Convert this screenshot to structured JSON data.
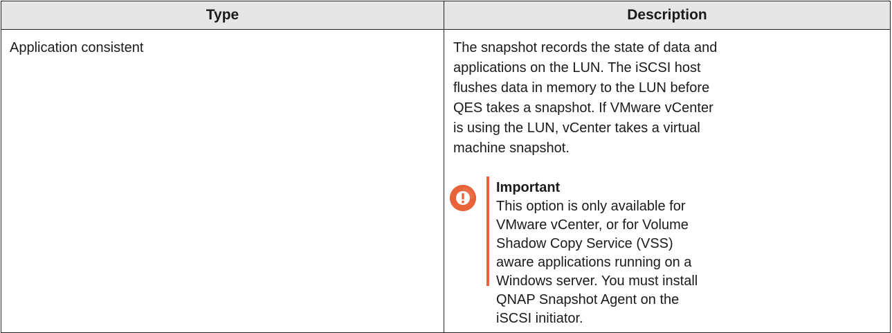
{
  "table": {
    "headers": {
      "type": "Type",
      "description": "Description"
    },
    "rows": [
      {
        "type": "Application consistent",
        "description": "The snapshot records the state of data and applications on the LUN. The iSCSI host flushes data in memory to the LUN before QES takes a snapshot. If VMware vCenter is using the LUN, vCenter takes a virtual machine snapshot.",
        "notice": {
          "icon": "important-icon",
          "title": "Important",
          "text": "This option is only available for VMware vCenter, or for Volume Shadow Copy Service (VSS) aware applications running on a Windows server. You must install QNAP Snapshot Agent on the iSCSI initiator."
        }
      }
    ]
  },
  "colors": {
    "header_background": "#e6e6e6",
    "accent": "#e8633a",
    "border": "#1f1f1f"
  }
}
